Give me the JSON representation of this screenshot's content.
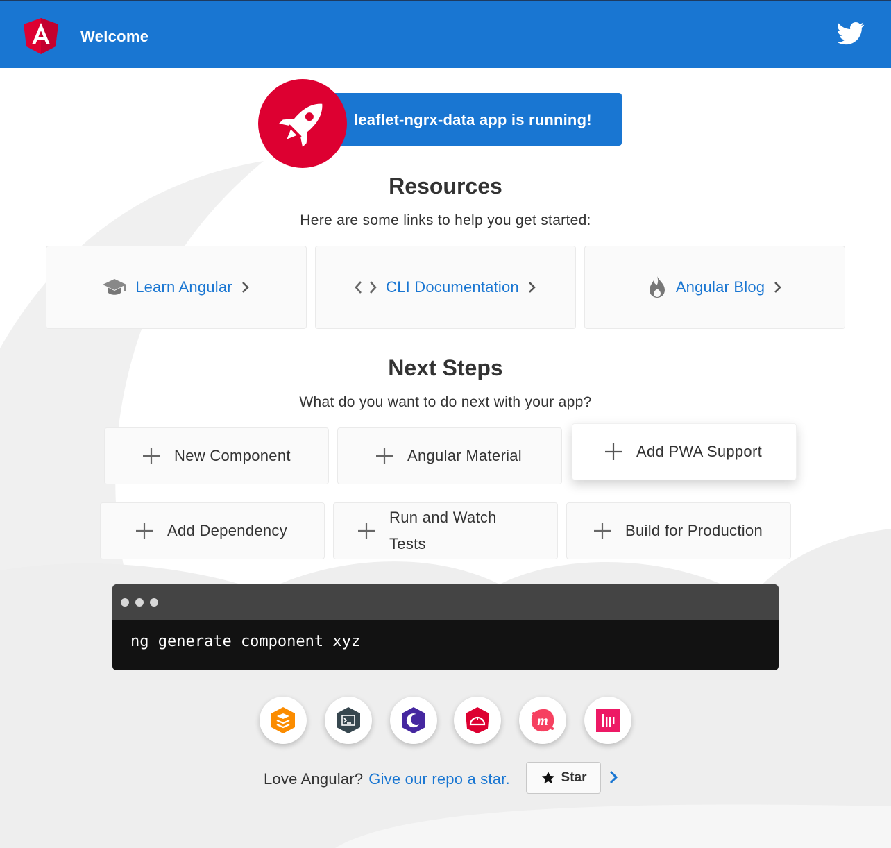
{
  "toolbar": {
    "title": "Welcome",
    "logo_icon": "angular-logo-icon",
    "social_icon": "twitter-icon"
  },
  "banner": {
    "text": "leaflet-ngrx-data app is running!",
    "icon": "rocket-icon"
  },
  "resources": {
    "heading": "Resources",
    "subheading": "Here are some links to help you get started:",
    "cards": [
      {
        "label": "Learn Angular",
        "icon": "graduation-cap-icon"
      },
      {
        "label": "CLI Documentation",
        "icon": "code-brackets-icon"
      },
      {
        "label": "Angular Blog",
        "icon": "flame-icon"
      }
    ]
  },
  "next_steps": {
    "heading": "Next Steps",
    "subheading": "What do you want to do next with your app?",
    "cards": [
      {
        "label": "New Component",
        "active": false
      },
      {
        "label": "Angular Material",
        "active": false
      },
      {
        "label": "Add PWA Support",
        "active": true
      },
      {
        "label": "Add Dependency",
        "active": false
      },
      {
        "label": "Run and Watch Tests",
        "active": false
      },
      {
        "label": "Build for Production",
        "active": false
      }
    ]
  },
  "terminal": {
    "command": "ng generate component xyz"
  },
  "ecosystem_links": [
    "animations-icon",
    "cli-icon",
    "augury-icon",
    "protractor-icon",
    "meetup-icon",
    "gitter-icon"
  ],
  "footer": {
    "love_text": "Love Angular?",
    "link_text": "Give our repo a star.",
    "star_label": "Star"
  },
  "colors": {
    "primary": "#1976d2",
    "angular_red": "#dd0031",
    "terminal_bg": "#121212",
    "terminal_bar": "#444444"
  }
}
